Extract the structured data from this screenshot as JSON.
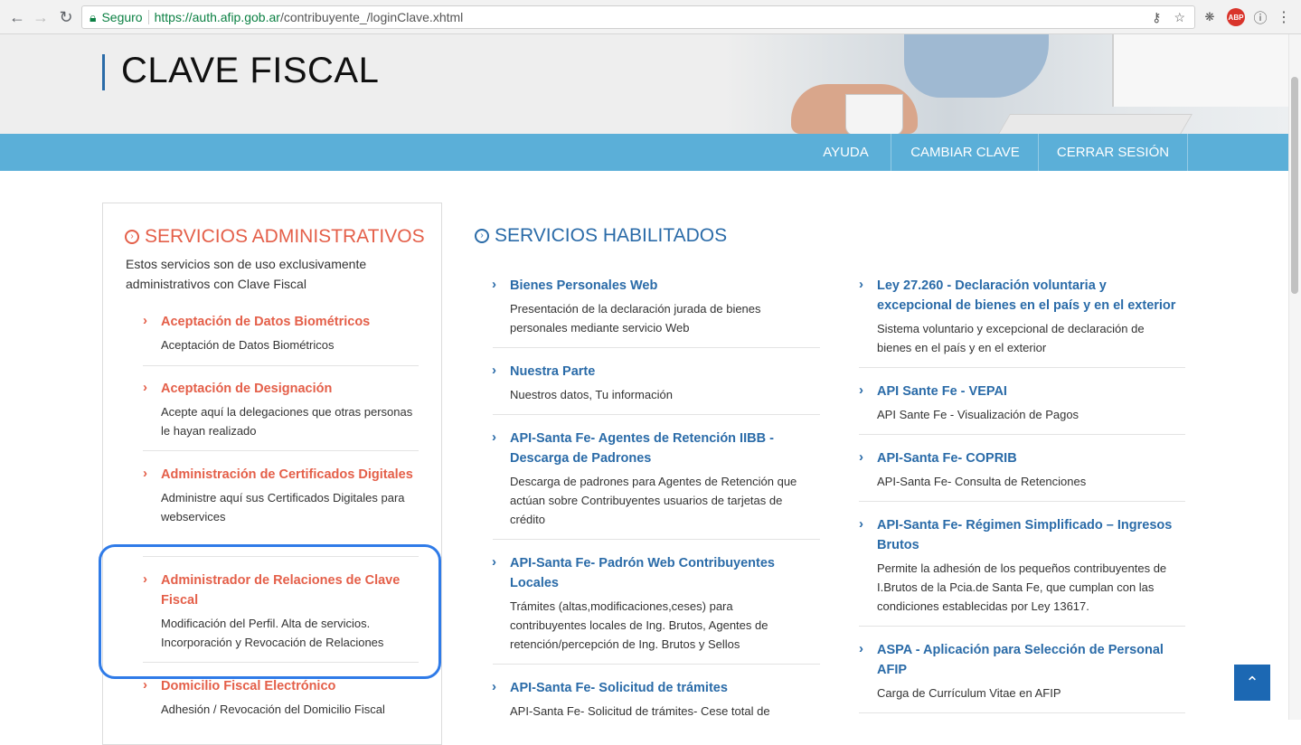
{
  "browser": {
    "secure_label": "Seguro",
    "url_host": "https://auth.afip.gob.ar",
    "url_path": "/contribuyente_/loginClave.xhtml",
    "abp_label": "ABP"
  },
  "header": {
    "title": "CLAVE FISCAL",
    "nav": [
      "AYUDA",
      "CAMBIAR CLAVE",
      "CERRAR SESIÓN"
    ]
  },
  "admin": {
    "title": "SERVICIOS ADMINISTRATIVOS",
    "description": "Estos servicios son de uso exclusivamente administrativos con Clave Fiscal",
    "items": [
      {
        "title": "Aceptación de Datos Biométricos",
        "desc": "Aceptación de Datos Biométricos"
      },
      {
        "title": "Aceptación de Designación",
        "desc": "Acepte aquí la delegaciones que otras personas le hayan realizado"
      },
      {
        "title": "Administración de Certificados Digitales",
        "desc": "Administre aquí sus Certificados Digitales para webservices"
      },
      {
        "title": "Administrador de Relaciones de Clave Fiscal",
        "desc": "Modificación del Perfil. Alta de servicios. Incorporación y Revocación de Relaciones"
      },
      {
        "title": "Domicilio Fiscal Electrónico",
        "desc": "Adhesión / Revocación del Domicilio Fiscal"
      }
    ]
  },
  "enabled": {
    "title": "SERVICIOS HABILITADOS",
    "col1": [
      {
        "title": "Bienes Personales Web",
        "desc": "Presentación de la declaración jurada de bienes personales mediante servicio Web"
      },
      {
        "title": "Nuestra Parte",
        "desc": "Nuestros datos, Tu información"
      },
      {
        "title": "API-Santa Fe- Agentes de Retención IIBB - Descarga de Padrones",
        "desc": "Descarga de padrones para Agentes de Retención que actúan sobre Contribuyentes usuarios de tarjetas de crédito"
      },
      {
        "title": "API-Santa Fe- Padrón Web Contribuyentes Locales",
        "desc": "Trámites (altas,modificaciones,ceses) para contribuyentes locales de Ing. Brutos, Agentes de retención/percepción de Ing. Brutos y Sellos"
      },
      {
        "title": "API-Santa Fe- Solicitud de trámites",
        "desc": "API-Santa Fe- Solicitud de trámites- Cese total de"
      }
    ],
    "col2": [
      {
        "title": "Ley 27.260 - Declaración voluntaria y excepcional de bienes en el país y en el exterior",
        "desc": "Sistema voluntario y excepcional de declaración de bienes en el país y en el exterior"
      },
      {
        "title": "API Sante Fe - VEPAI",
        "desc": "API Sante Fe - Visualización de Pagos"
      },
      {
        "title": "API-Santa Fe- COPRIB",
        "desc": "API-Santa Fe- Consulta de Retenciones"
      },
      {
        "title": "API-Santa Fe- Régimen Simplificado – Ingresos Brutos",
        "desc": "Permite la adhesión de los pequeños contribuyentes de I.Brutos de la Pcia.de Santa Fe, que cumplan con las condiciones establecidas por Ley 13617."
      },
      {
        "title": "ASPA - Aplicación para Selección de Personal AFIP",
        "desc": "Carga de Currículum Vitae en AFIP"
      }
    ]
  }
}
